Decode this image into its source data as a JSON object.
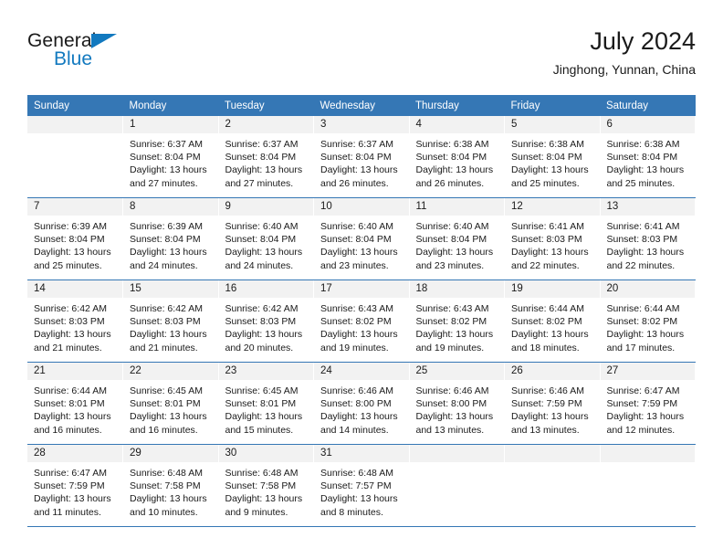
{
  "brand": {
    "name_top": "General",
    "name_bottom": "Blue",
    "accent_color": "#1279bf"
  },
  "header": {
    "title": "July 2024",
    "subtitle": "Jinghong, Yunnan, China"
  },
  "theme": {
    "header_row_bg": "#3577b5",
    "daynum_bg": "#f2f2f2",
    "grid_line": "#3577b5",
    "text": "#1a1a1a"
  },
  "weekday_headers": [
    "Sunday",
    "Monday",
    "Tuesday",
    "Wednesday",
    "Thursday",
    "Friday",
    "Saturday"
  ],
  "weeks": [
    [
      {
        "day": "",
        "sunrise": "",
        "sunset": "",
        "daylight_line1": "",
        "daylight_line2": "",
        "empty": true
      },
      {
        "day": "1",
        "sunrise": "Sunrise: 6:37 AM",
        "sunset": "Sunset: 8:04 PM",
        "daylight_line1": "Daylight: 13 hours",
        "daylight_line2": "and 27 minutes."
      },
      {
        "day": "2",
        "sunrise": "Sunrise: 6:37 AM",
        "sunset": "Sunset: 8:04 PM",
        "daylight_line1": "Daylight: 13 hours",
        "daylight_line2": "and 27 minutes."
      },
      {
        "day": "3",
        "sunrise": "Sunrise: 6:37 AM",
        "sunset": "Sunset: 8:04 PM",
        "daylight_line1": "Daylight: 13 hours",
        "daylight_line2": "and 26 minutes."
      },
      {
        "day": "4",
        "sunrise": "Sunrise: 6:38 AM",
        "sunset": "Sunset: 8:04 PM",
        "daylight_line1": "Daylight: 13 hours",
        "daylight_line2": "and 26 minutes."
      },
      {
        "day": "5",
        "sunrise": "Sunrise: 6:38 AM",
        "sunset": "Sunset: 8:04 PM",
        "daylight_line1": "Daylight: 13 hours",
        "daylight_line2": "and 25 minutes."
      },
      {
        "day": "6",
        "sunrise": "Sunrise: 6:38 AM",
        "sunset": "Sunset: 8:04 PM",
        "daylight_line1": "Daylight: 13 hours",
        "daylight_line2": "and 25 minutes."
      }
    ],
    [
      {
        "day": "7",
        "sunrise": "Sunrise: 6:39 AM",
        "sunset": "Sunset: 8:04 PM",
        "daylight_line1": "Daylight: 13 hours",
        "daylight_line2": "and 25 minutes."
      },
      {
        "day": "8",
        "sunrise": "Sunrise: 6:39 AM",
        "sunset": "Sunset: 8:04 PM",
        "daylight_line1": "Daylight: 13 hours",
        "daylight_line2": "and 24 minutes."
      },
      {
        "day": "9",
        "sunrise": "Sunrise: 6:40 AM",
        "sunset": "Sunset: 8:04 PM",
        "daylight_line1": "Daylight: 13 hours",
        "daylight_line2": "and 24 minutes."
      },
      {
        "day": "10",
        "sunrise": "Sunrise: 6:40 AM",
        "sunset": "Sunset: 8:04 PM",
        "daylight_line1": "Daylight: 13 hours",
        "daylight_line2": "and 23 minutes."
      },
      {
        "day": "11",
        "sunrise": "Sunrise: 6:40 AM",
        "sunset": "Sunset: 8:04 PM",
        "daylight_line1": "Daylight: 13 hours",
        "daylight_line2": "and 23 minutes."
      },
      {
        "day": "12",
        "sunrise": "Sunrise: 6:41 AM",
        "sunset": "Sunset: 8:03 PM",
        "daylight_line1": "Daylight: 13 hours",
        "daylight_line2": "and 22 minutes."
      },
      {
        "day": "13",
        "sunrise": "Sunrise: 6:41 AM",
        "sunset": "Sunset: 8:03 PM",
        "daylight_line1": "Daylight: 13 hours",
        "daylight_line2": "and 22 minutes."
      }
    ],
    [
      {
        "day": "14",
        "sunrise": "Sunrise: 6:42 AM",
        "sunset": "Sunset: 8:03 PM",
        "daylight_line1": "Daylight: 13 hours",
        "daylight_line2": "and 21 minutes."
      },
      {
        "day": "15",
        "sunrise": "Sunrise: 6:42 AM",
        "sunset": "Sunset: 8:03 PM",
        "daylight_line1": "Daylight: 13 hours",
        "daylight_line2": "and 21 minutes."
      },
      {
        "day": "16",
        "sunrise": "Sunrise: 6:42 AM",
        "sunset": "Sunset: 8:03 PM",
        "daylight_line1": "Daylight: 13 hours",
        "daylight_line2": "and 20 minutes."
      },
      {
        "day": "17",
        "sunrise": "Sunrise: 6:43 AM",
        "sunset": "Sunset: 8:02 PM",
        "daylight_line1": "Daylight: 13 hours",
        "daylight_line2": "and 19 minutes."
      },
      {
        "day": "18",
        "sunrise": "Sunrise: 6:43 AM",
        "sunset": "Sunset: 8:02 PM",
        "daylight_line1": "Daylight: 13 hours",
        "daylight_line2": "and 19 minutes."
      },
      {
        "day": "19",
        "sunrise": "Sunrise: 6:44 AM",
        "sunset": "Sunset: 8:02 PM",
        "daylight_line1": "Daylight: 13 hours",
        "daylight_line2": "and 18 minutes."
      },
      {
        "day": "20",
        "sunrise": "Sunrise: 6:44 AM",
        "sunset": "Sunset: 8:02 PM",
        "daylight_line1": "Daylight: 13 hours",
        "daylight_line2": "and 17 minutes."
      }
    ],
    [
      {
        "day": "21",
        "sunrise": "Sunrise: 6:44 AM",
        "sunset": "Sunset: 8:01 PM",
        "daylight_line1": "Daylight: 13 hours",
        "daylight_line2": "and 16 minutes."
      },
      {
        "day": "22",
        "sunrise": "Sunrise: 6:45 AM",
        "sunset": "Sunset: 8:01 PM",
        "daylight_line1": "Daylight: 13 hours",
        "daylight_line2": "and 16 minutes."
      },
      {
        "day": "23",
        "sunrise": "Sunrise: 6:45 AM",
        "sunset": "Sunset: 8:01 PM",
        "daylight_line1": "Daylight: 13 hours",
        "daylight_line2": "and 15 minutes."
      },
      {
        "day": "24",
        "sunrise": "Sunrise: 6:46 AM",
        "sunset": "Sunset: 8:00 PM",
        "daylight_line1": "Daylight: 13 hours",
        "daylight_line2": "and 14 minutes."
      },
      {
        "day": "25",
        "sunrise": "Sunrise: 6:46 AM",
        "sunset": "Sunset: 8:00 PM",
        "daylight_line1": "Daylight: 13 hours",
        "daylight_line2": "and 13 minutes."
      },
      {
        "day": "26",
        "sunrise": "Sunrise: 6:46 AM",
        "sunset": "Sunset: 7:59 PM",
        "daylight_line1": "Daylight: 13 hours",
        "daylight_line2": "and 13 minutes."
      },
      {
        "day": "27",
        "sunrise": "Sunrise: 6:47 AM",
        "sunset": "Sunset: 7:59 PM",
        "daylight_line1": "Daylight: 13 hours",
        "daylight_line2": "and 12 minutes."
      }
    ],
    [
      {
        "day": "28",
        "sunrise": "Sunrise: 6:47 AM",
        "sunset": "Sunset: 7:59 PM",
        "daylight_line1": "Daylight: 13 hours",
        "daylight_line2": "and 11 minutes."
      },
      {
        "day": "29",
        "sunrise": "Sunrise: 6:48 AM",
        "sunset": "Sunset: 7:58 PM",
        "daylight_line1": "Daylight: 13 hours",
        "daylight_line2": "and 10 minutes."
      },
      {
        "day": "30",
        "sunrise": "Sunrise: 6:48 AM",
        "sunset": "Sunset: 7:58 PM",
        "daylight_line1": "Daylight: 13 hours",
        "daylight_line2": "and 9 minutes."
      },
      {
        "day": "31",
        "sunrise": "Sunrise: 6:48 AM",
        "sunset": "Sunset: 7:57 PM",
        "daylight_line1": "Daylight: 13 hours",
        "daylight_line2": "and 8 minutes."
      },
      {
        "day": "",
        "sunrise": "",
        "sunset": "",
        "daylight_line1": "",
        "daylight_line2": "",
        "empty": true
      },
      {
        "day": "",
        "sunrise": "",
        "sunset": "",
        "daylight_line1": "",
        "daylight_line2": "",
        "empty": true
      },
      {
        "day": "",
        "sunrise": "",
        "sunset": "",
        "daylight_line1": "",
        "daylight_line2": "",
        "empty": true
      }
    ]
  ]
}
